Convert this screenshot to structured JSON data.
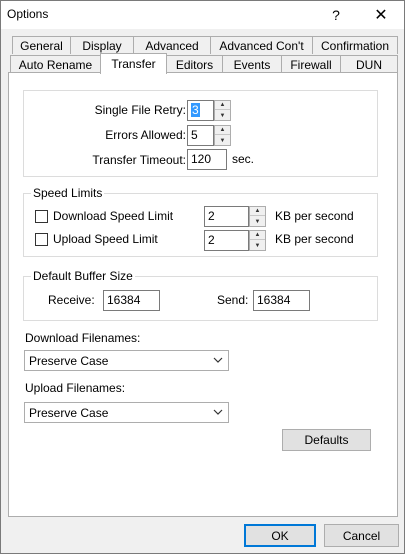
{
  "window": {
    "title": "Options",
    "help_glyph": "?",
    "close_glyph": "✕"
  },
  "tabs_row1": [
    {
      "label": "General"
    },
    {
      "label": "Display"
    },
    {
      "label": "Advanced"
    },
    {
      "label": "Advanced Con't"
    },
    {
      "label": "Confirmation"
    }
  ],
  "tabs_row2": [
    {
      "label": "Auto Rename"
    },
    {
      "label": "Transfer",
      "active": true
    },
    {
      "label": "Editors"
    },
    {
      "label": "Events"
    },
    {
      "label": "Firewall"
    },
    {
      "label": "DUN"
    }
  ],
  "transfer": {
    "single_file_retry_label": "Single File Retry:",
    "single_file_retry_value": "3",
    "errors_allowed_label": "Errors Allowed:",
    "errors_allowed_value": "5",
    "transfer_timeout_label": "Transfer Timeout:",
    "transfer_timeout_value": "120",
    "transfer_timeout_unit": "sec."
  },
  "speed_limits": {
    "title": "Speed Limits",
    "download_label": "Download Speed Limit",
    "download_value": "2",
    "download_unit": "KB per second",
    "download_checked": false,
    "upload_label": "Upload Speed Limit",
    "upload_value": "2",
    "upload_unit": "KB per second",
    "upload_checked": false
  },
  "buffer": {
    "title": "Default Buffer Size",
    "receive_label": "Receive:",
    "receive_value": "16384",
    "send_label": "Send:",
    "send_value": "16384"
  },
  "filenames": {
    "download_label": "Download Filenames:",
    "download_value": "Preserve Case",
    "upload_label": "Upload Filenames:",
    "upload_value": "Preserve Case"
  },
  "buttons": {
    "defaults": "Defaults",
    "ok": "OK",
    "cancel": "Cancel"
  }
}
